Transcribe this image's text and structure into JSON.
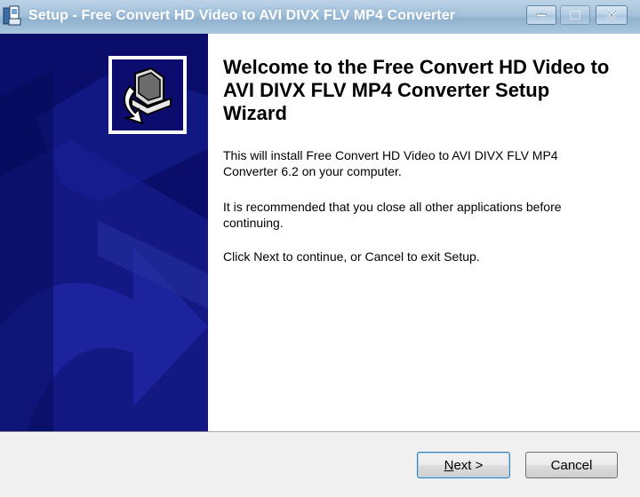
{
  "window": {
    "title": "Setup - Free Convert HD Video to AVI DIVX FLV MP4 Converter"
  },
  "titlebar_buttons": {
    "minimize_icon": "minimize-icon",
    "maximize_icon": "maximize-icon",
    "close_icon": "close-icon"
  },
  "wizard": {
    "heading": "Welcome to the Free Convert HD Video to AVI DIVX FLV MP4 Converter Setup Wizard",
    "paragraph1": "This will install Free Convert HD Video to AVI DIVX FLV MP4 Converter 6.2 on your computer.",
    "paragraph2": "It is recommended that you close all other applications before continuing.",
    "paragraph3": "Click Next to continue, or Cancel to exit Setup."
  },
  "buttons": {
    "next_label": "Next >",
    "cancel_label": "Cancel"
  },
  "colors": {
    "side_panel": "#0c1070",
    "titlebar": "#a4c1da",
    "content_bg": "#ffffff"
  }
}
